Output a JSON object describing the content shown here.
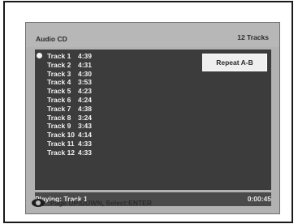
{
  "header": {
    "title": "Audio CD",
    "track_count": "12 Tracks"
  },
  "tracks": [
    {
      "name": "Track 1",
      "time": "4:39"
    },
    {
      "name": "Track 2",
      "time": "4:31"
    },
    {
      "name": "Track 3",
      "time": "4:30"
    },
    {
      "name": "Track 4",
      "time": "3:53"
    },
    {
      "name": "Track 5",
      "time": "4:23"
    },
    {
      "name": "Track 6",
      "time": "4:24"
    },
    {
      "name": "Track 7",
      "time": "4:38"
    },
    {
      "name": "Track 8",
      "time": "3:24"
    },
    {
      "name": "Track 9",
      "time": "3:43"
    },
    {
      "name": "Track 10",
      "time": "4:14"
    },
    {
      "name": "Track 11",
      "time": "4:33"
    },
    {
      "name": "Track 12",
      "time": "4:33"
    }
  ],
  "repeat_button": {
    "label": "Repeat A-B"
  },
  "status": {
    "playing": "Playing: Track 1",
    "elapsed": "0:00:45"
  },
  "help": {
    "icon": "eye-icon",
    "text": ":Page UP/DOWN, Select:ENTER"
  },
  "colors": {
    "screen_bg": "#b2b2b2",
    "panel_bg": "#3c3c3c",
    "status_bg": "#4a4a4a",
    "text_light": "#f2f2f2",
    "text_dark": "#2b2b2b"
  }
}
